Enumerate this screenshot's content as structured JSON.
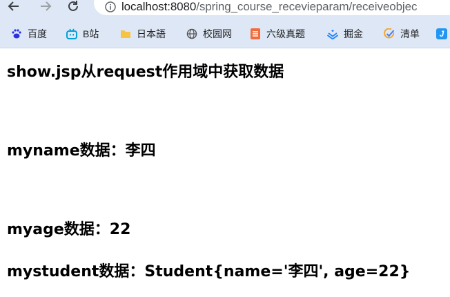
{
  "browser": {
    "url_host": "localhost:8080",
    "url_path": "/spring_course_recevieparam/receiveobjec",
    "icons": {
      "back": "back-arrow-icon",
      "forward": "forward-arrow-icon",
      "reload": "reload-icon",
      "info": "info-icon"
    }
  },
  "bookmarks": [
    {
      "label": "百度",
      "icon": "baidu-paw-icon",
      "color": "#2932e1"
    },
    {
      "label": "B站",
      "icon": "bilibili-tv-icon",
      "color": "#00a1d6"
    },
    {
      "label": "日本語",
      "icon": "folder-icon",
      "color": "#f6c343"
    },
    {
      "label": "校园网",
      "icon": "globe-icon",
      "color": "#555555"
    },
    {
      "label": "六级真题",
      "icon": "document-icon",
      "color": "#f26b3a"
    },
    {
      "label": "掘金",
      "icon": "juejin-icon",
      "color": "#1e80ff"
    },
    {
      "label": "清单",
      "icon": "check-circle-icon",
      "color": "#4a7cf6"
    },
    {
      "label": "J",
      "icon": "j-icon",
      "color": "#2196f3"
    }
  ],
  "page": {
    "heading": "show.jsp从request作用域中获取数据",
    "myname": "myname数据：李四",
    "myage": "myage数据：22",
    "mystudent": "mystudent数据：Student{name='李四', age=22}"
  }
}
